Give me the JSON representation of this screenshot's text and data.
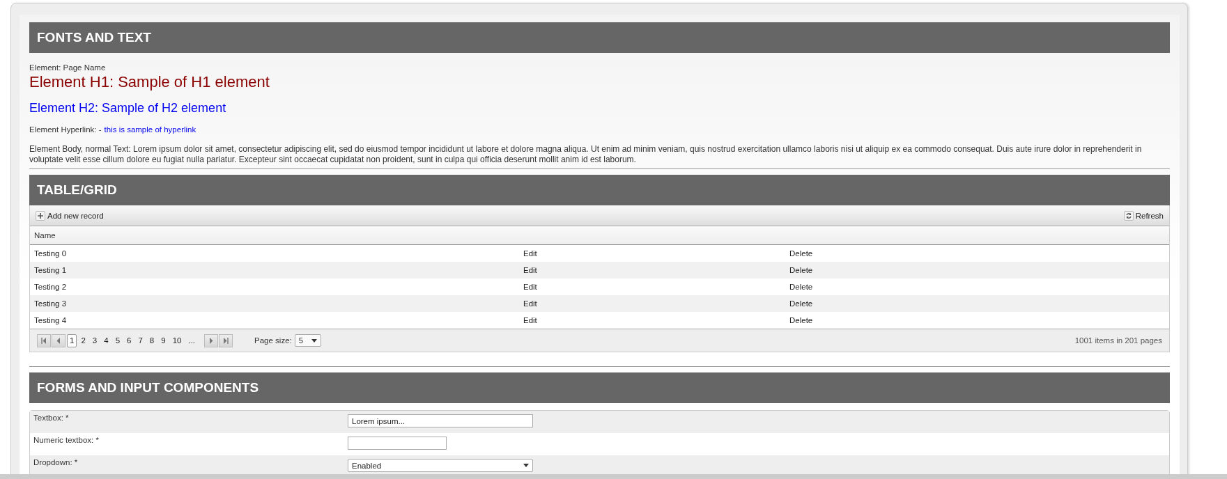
{
  "sections": [
    {
      "kind": "text",
      "title": "FONTS AND TEXT"
    },
    {
      "kind": "grid",
      "title": "TABLE/GRID"
    },
    {
      "kind": "forms",
      "title": "FORMS AND INPUT COMPONENTS"
    }
  ],
  "text_samples": {
    "page_name": "Element: Page Name",
    "h1": "Element H1: Sample of H1 element",
    "h2": "Element H2: Sample of H2 element",
    "hyperlink_label": "Element Hyperlink: -",
    "hyperlink": "this is sample of hyperlink",
    "body": "Element Body, normal Text: Lorem ipsum dolor sit amet, consectetur adipiscing elit, sed do eiusmod tempor incididunt ut labore et dolore magna aliqua. Ut enim ad minim veniam, quis nostrud exercitation ullamco laboris nisi ut aliquip ex ea commodo consequat. Duis aute irure dolor in reprehenderit in voluptate velit esse cillum dolore eu fugiat nulla pariatur. Excepteur sint occaecat cupidatat non proident, sunt in culpa qui officia deserunt mollit anim id est laborum."
  },
  "grid": {
    "toolbar": {
      "add": "Add new record",
      "refresh": "Refresh"
    },
    "columns": [
      "Name"
    ],
    "rows": [
      {
        "name": "Testing 0",
        "edit": "Edit",
        "delete": "Delete"
      },
      {
        "name": "Testing 1",
        "edit": "Edit",
        "delete": "Delete"
      },
      {
        "name": "Testing 2",
        "edit": "Edit",
        "delete": "Delete"
      },
      {
        "name": "Testing 3",
        "edit": "Edit",
        "delete": "Delete"
      },
      {
        "name": "Testing 4",
        "edit": "Edit",
        "delete": "Delete"
      }
    ],
    "pager": {
      "pages": [
        {
          "label": "1",
          "selected": true
        },
        {
          "label": "2",
          "selected": false
        },
        {
          "label": "3",
          "selected": false
        },
        {
          "label": "4",
          "selected": false
        },
        {
          "label": "5",
          "selected": false
        },
        {
          "label": "6",
          "selected": false
        },
        {
          "label": "7",
          "selected": false
        },
        {
          "label": "8",
          "selected": false
        },
        {
          "label": "9",
          "selected": false
        },
        {
          "label": "10",
          "selected": false
        },
        {
          "label": "...",
          "selected": false
        }
      ],
      "page_size_label": "Page size:",
      "page_size": "5",
      "info": "1001 items in 201 pages"
    }
  },
  "form": [
    {
      "kind": "text",
      "label": "Textbox: *",
      "value": "Lorem ipsum..."
    },
    {
      "kind": "numeric",
      "label": "Numeric textbox: *"
    },
    {
      "kind": "dropdown",
      "label": "Dropdown: *",
      "value": "Enabled"
    }
  ]
}
